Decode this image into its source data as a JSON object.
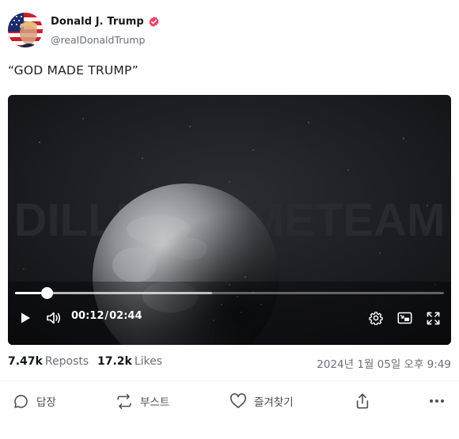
{
  "author": {
    "name": "Donald J. Trump",
    "handle": "@realDonaldTrump"
  },
  "post": {
    "text": "“GOD MADE TRUMP”"
  },
  "video": {
    "current_time": "00:12",
    "separator": "/",
    "duration": "02:44",
    "played_fraction": 0.073,
    "buffered_fraction": 0.46,
    "watermark": "DILLEYMEMETEAM"
  },
  "stats": {
    "reposts_count": "7.47k",
    "reposts_label": "Reposts",
    "likes_count": "17.2k",
    "likes_label": "Likes",
    "timestamp": "2024년 1월 05일 오후 9:49"
  },
  "actions": {
    "reply_label": "답장",
    "repost_label": "부스트",
    "favorite_label": "즐겨찾기"
  },
  "colors": {
    "verified_badge": "#e8466b",
    "video_background": "#141518",
    "text_muted": "#6b6f75"
  }
}
